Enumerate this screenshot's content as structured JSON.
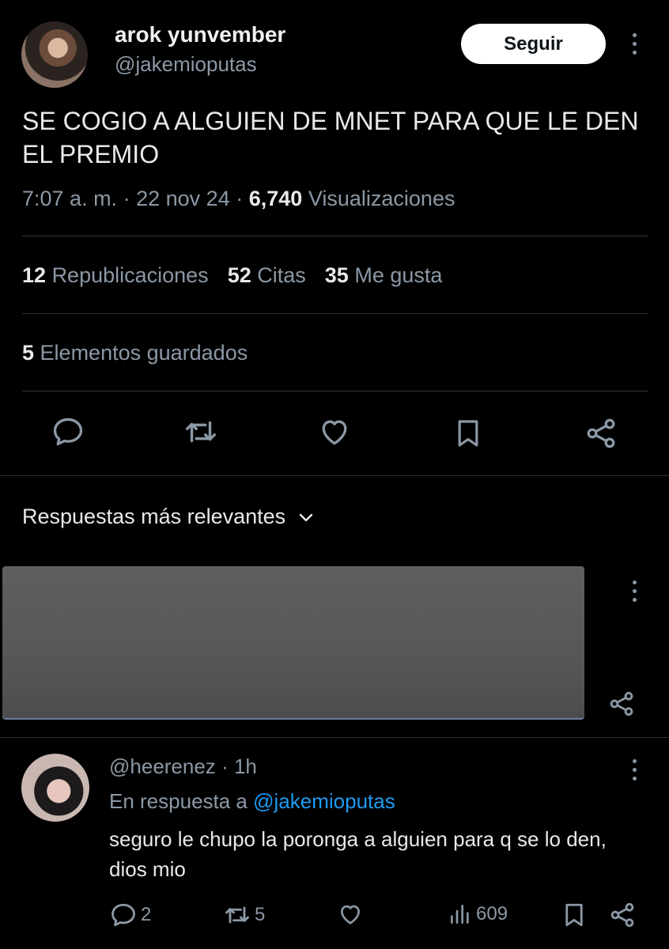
{
  "tweet": {
    "display_name": "arok yunvember",
    "handle": "@jakemioputas",
    "follow_label": "Seguir",
    "text": "SE COGIO A ALGUIEN  DE MNET PARA QUE LE DEN EL PREMIO",
    "time": "7:07 a. m.",
    "date": "22 nov 24",
    "views_count": "6,740",
    "views_label": "Visualizaciones",
    "sep": "·",
    "stats": {
      "reposts_count": "12",
      "reposts_label": "Republicaciones",
      "quotes_count": "52",
      "quotes_label": "Citas",
      "likes_count": "35",
      "likes_label": "Me gusta",
      "bookmarks_count": "5",
      "bookmarks_label": "Elementos guardados"
    },
    "actions": [
      "reply-icon",
      "repost-icon",
      "like-icon",
      "bookmark-icon",
      "share-icon"
    ]
  },
  "replies_sort": {
    "label": "Respuestas más relevantes",
    "icon": "chevron-down-icon"
  },
  "reply": {
    "handle": "@heerenez",
    "time": "1h",
    "in_reply_prefix": "En respuesta a",
    "in_reply_handle": "@jakemioputas",
    "text": "seguro le chupo la poronga a alguien para q se lo den, dios mio",
    "reply_count": "2",
    "repost_count": "5",
    "views_count": "609"
  },
  "colors": {
    "background": "#000000",
    "text": "#e7e9ea",
    "muted": "#8b98a5",
    "link": "#1d9bf0",
    "divider": "#2f3336"
  }
}
